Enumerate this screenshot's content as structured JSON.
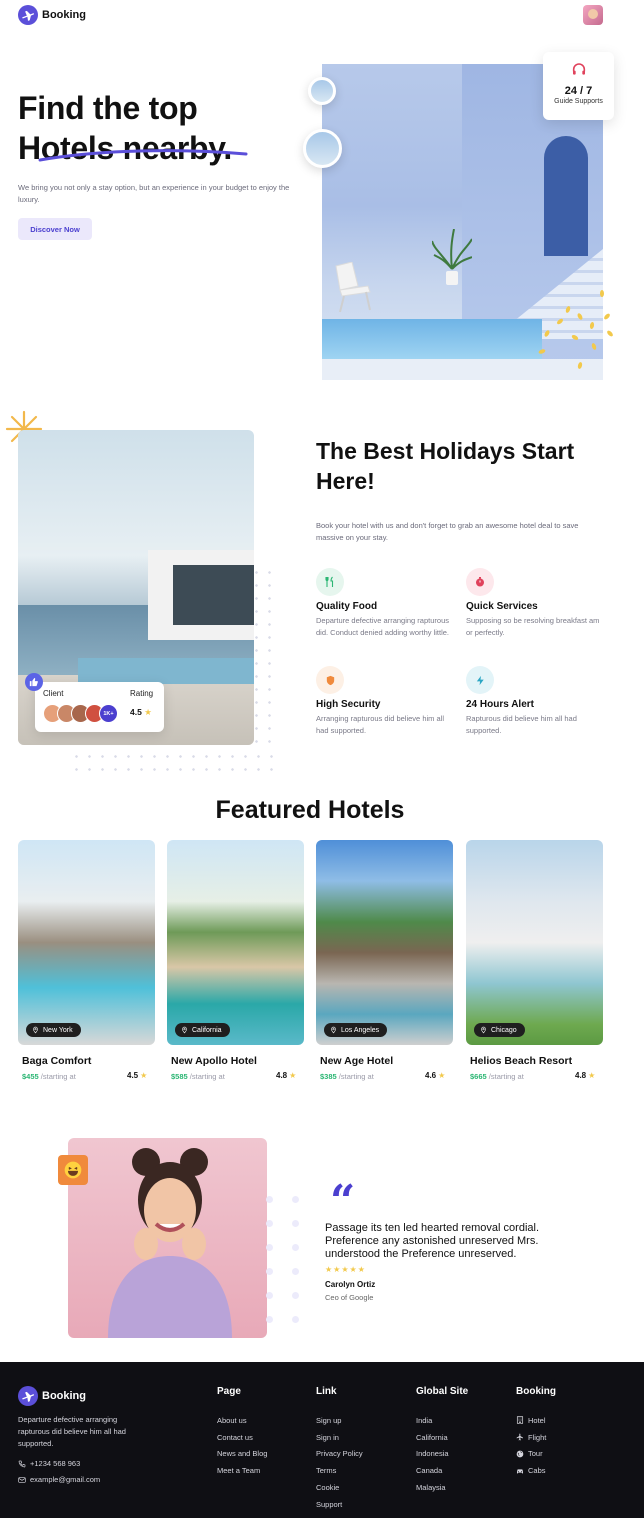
{
  "header": {
    "brand": "Booking"
  },
  "hero": {
    "title_line1": "Find the top",
    "title_line2": "Hotels nearby.",
    "description": "We bring you not only a stay option, but an experience in your budget to enjoy the luxury.",
    "cta_label": "Discover Now",
    "support_value": "24 / 7",
    "support_label": "Guide Supports"
  },
  "holidays": {
    "client_label": "Client",
    "rating_label": "Rating",
    "rating_value": "4.5",
    "client_more": "1K+",
    "title": "The Best Holidays Start Here!",
    "description": "Book your hotel with us and don't forget to grab an awesome hotel deal to save massive on your stay.",
    "features": [
      {
        "title": "Quality Food",
        "text": "Departure defective arranging rapturous did. Conduct denied adding worthy little.",
        "icon": "utensils-icon",
        "color": "#2bb673",
        "bg": "#e6f6ee"
      },
      {
        "title": "Quick Services",
        "text": "Supposing so be resolving breakfast am or perfectly.",
        "icon": "timer-icon",
        "color": "#e0425c",
        "bg": "#fde8ec"
      },
      {
        "title": "High Security",
        "text": "Arranging rapturous did believe him all had supported.",
        "icon": "shield-icon",
        "color": "#f08a3c",
        "bg": "#fdf0e5"
      },
      {
        "title": "24 Hours Alert",
        "text": "Rapturous did believe him all had supported.",
        "icon": "bolt-icon",
        "color": "#2ba6c4",
        "bg": "#e3f4f8"
      }
    ]
  },
  "featured": {
    "title": "Featured Hotels",
    "starting_at": "/starting at",
    "hotels": [
      {
        "name": "Baga Comfort",
        "location": "New York",
        "price": "$455",
        "rating": "4.5"
      },
      {
        "name": "New Apollo Hotel",
        "location": "California",
        "price": "$585",
        "rating": "4.8"
      },
      {
        "name": "New Age Hotel",
        "location": "Los Angeles",
        "price": "$385",
        "rating": "4.6"
      },
      {
        "name": "Helios Beach Resort",
        "location": "Chicago",
        "price": "$665",
        "rating": "4.8"
      }
    ]
  },
  "testimonial": {
    "quote": "Passage its ten led hearted removal cordial. Preference any astonished unreserved Mrs. understood the Preference unreserved.",
    "name": "Carolyn Ortiz",
    "role": "Ceo of Google",
    "stars": 5
  },
  "footer": {
    "brand": "Booking",
    "description": "Departure defective arranging rapturous did believe him all had supported.",
    "phone": "+1234 568 963",
    "email": "example@gmail.com",
    "columns": [
      {
        "title": "Page",
        "links": [
          "About us",
          "Contact us",
          "News and Blog",
          "Meet a Team"
        ]
      },
      {
        "title": "Link",
        "links": [
          "Sign up",
          "Sign in",
          "Privacy Policy",
          "Terms",
          "Cookie",
          "Support"
        ]
      },
      {
        "title": "Global Site",
        "links": [
          "India",
          "California",
          "Indonesia",
          "Canada",
          "Malaysia"
        ]
      },
      {
        "title": "Booking",
        "links": [
          "Hotel",
          "Flight",
          "Tour",
          "Cabs"
        ]
      }
    ]
  },
  "colors": {
    "accent": "#4b3fcf",
    "price_green": "#2bb673",
    "footer_bg": "#0f0f14",
    "star": "#f2c94c"
  }
}
